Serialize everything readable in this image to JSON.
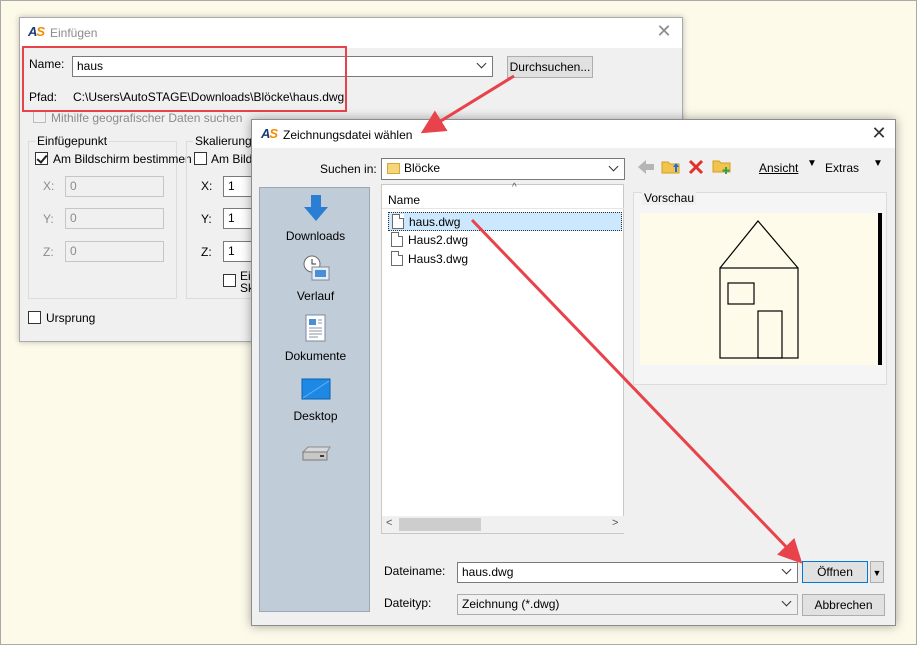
{
  "insert_dialog": {
    "title": "Einfügen",
    "name_label": "Name:",
    "name_value": "haus",
    "browse_button": "Durchsuchen...",
    "path_label": "Pfad:",
    "path_value": "C:\\Users\\AutoSTAGE\\Downloads\\Blöcke\\haus.dwg",
    "geo_checkbox": "Mithilfe geografischer Daten suchen",
    "insertion_group": {
      "title": "Einfügepunkt",
      "on_screen": "Am Bildschirm bestimmen",
      "x_label": "X:",
      "x_value": "0",
      "y_label": "Y:",
      "y_value": "0",
      "z_label": "Z:",
      "z_value": "0"
    },
    "scale_group": {
      "title": "Skalierung",
      "on_screen": "Am Bildsc",
      "x_label": "X:",
      "x_value": "1",
      "y_label": "Y:",
      "y_value": "1",
      "z_label": "Z:",
      "z_value": "1",
      "uniform_line1": "Ein",
      "uniform_line2": "Sk"
    },
    "origin_checkbox": "Ursprung"
  },
  "file_dialog": {
    "title": "Zeichnungsdatei wählen",
    "look_in_label": "Suchen in:",
    "look_in_value": "Blöcke",
    "view_menu": "Ansicht",
    "tools_menu": "Extras",
    "places": [
      {
        "label": "Downloads"
      },
      {
        "label": "Verlauf"
      },
      {
        "label": "Dokumente"
      },
      {
        "label": "Desktop"
      }
    ],
    "column_name": "Name",
    "files": [
      {
        "name": "haus.dwg"
      },
      {
        "name": "Haus2.dwg"
      },
      {
        "name": "Haus3.dwg"
      }
    ],
    "preview_label": "Vorschau",
    "filename_label": "Dateiname:",
    "filename_value": "haus.dwg",
    "filetype_label": "Dateityp:",
    "filetype_value": "Zeichnung (*.dwg)",
    "open_button": "Öffnen",
    "cancel_button": "Abbrechen"
  },
  "colors": {
    "annotation_red": "#e8434a",
    "places_bar": "#c0ccd8",
    "selection": "#cce8ff",
    "preview_bg": "#fffbea"
  }
}
